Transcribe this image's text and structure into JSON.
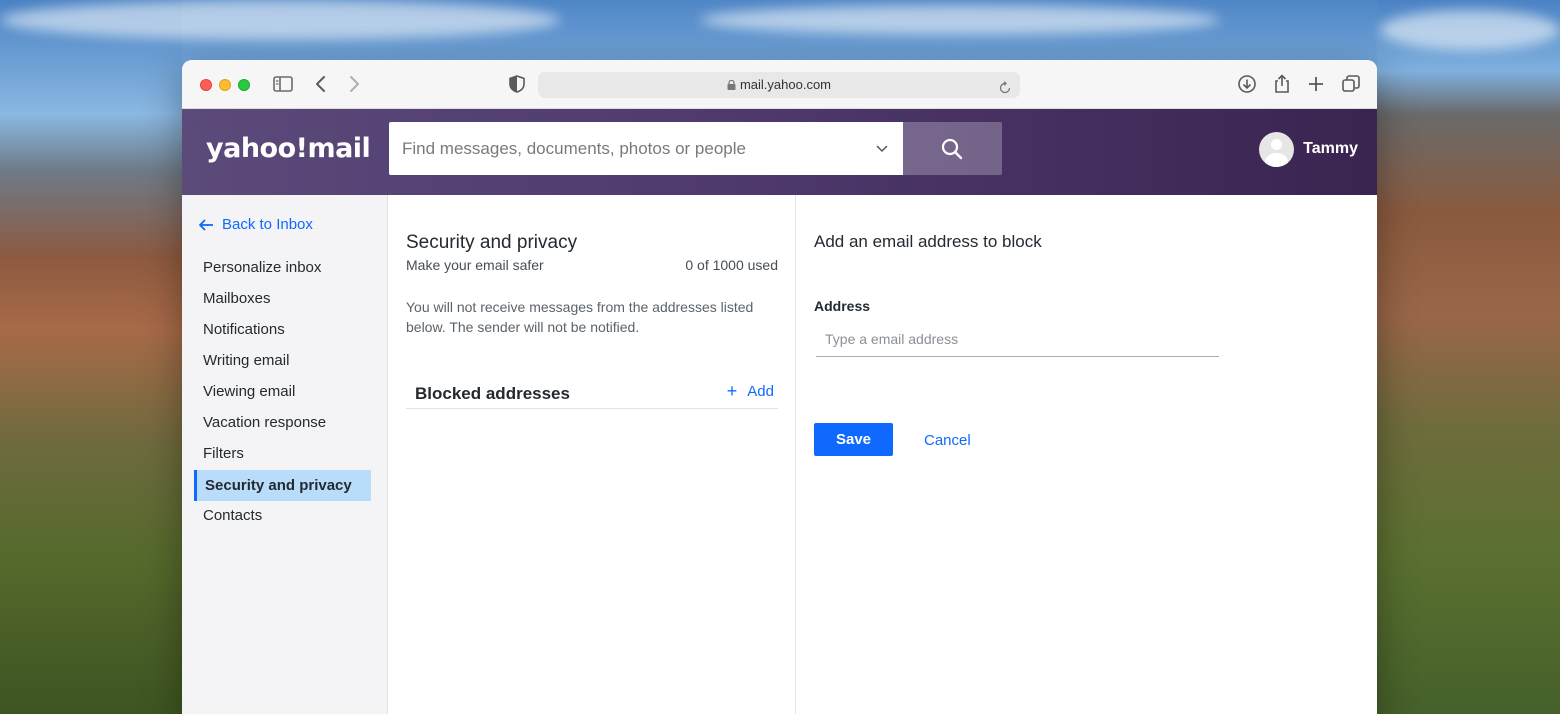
{
  "browser": {
    "url": "mail.yahoo.com"
  },
  "header": {
    "logo": "yahoo!mail",
    "search_placeholder": "Find messages, documents, photos or people",
    "user_name": "Tammy"
  },
  "sidebar": {
    "back_label": "Back to Inbox",
    "items": [
      {
        "label": "Personalize inbox",
        "active": false
      },
      {
        "label": "Mailboxes",
        "active": false
      },
      {
        "label": "Notifications",
        "active": false
      },
      {
        "label": "Writing email",
        "active": false
      },
      {
        "label": "Viewing email",
        "active": false
      },
      {
        "label": "Vacation response",
        "active": false
      },
      {
        "label": "Filters",
        "active": false
      },
      {
        "label": "Security and privacy",
        "active": true
      },
      {
        "label": "Contacts",
        "active": false
      }
    ]
  },
  "middle": {
    "title": "Security and privacy",
    "subtitle": "Make your email safer",
    "usage": "0 of 1000 used",
    "description": "You will not receive messages from the addresses listed below. The sender will not be notified.",
    "blocked_title": "Blocked addresses",
    "add_label": "Add"
  },
  "right": {
    "title": "Add an email address to block",
    "address_label": "Address",
    "address_placeholder": "Type a email address",
    "address_value": "",
    "save_label": "Save",
    "cancel_label": "Cancel"
  },
  "colors": {
    "accent": "#0f69ff",
    "header": "#4f3a6e",
    "active_nav": "#b9dcfb"
  }
}
